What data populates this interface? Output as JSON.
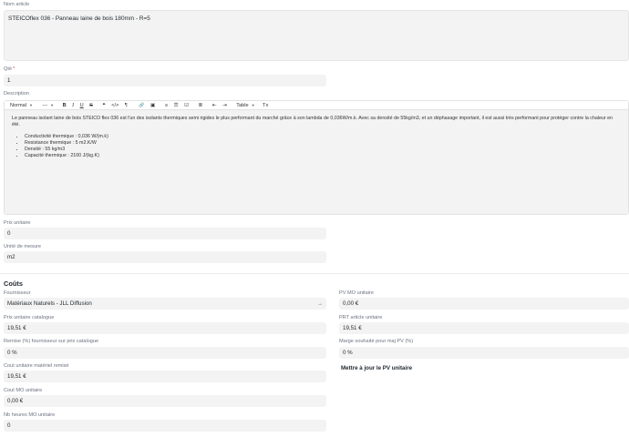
{
  "article": {
    "name_label": "Nom article",
    "name_value": "STEICOflex 036 - Panneau laine de bois 180mm - R=5",
    "qty_label": "Qté",
    "qty_required": "*",
    "qty_value": "1",
    "desc_label": "Description"
  },
  "toolbar": {
    "format": "Normal",
    "size": "---",
    "bold": "B",
    "italic": "I",
    "underline": "U",
    "strike": "S",
    "quote": "❝",
    "code": "</>",
    "rtl": "¶",
    "link": "🔗",
    "image": "▣",
    "ordered_list": "≡",
    "bullet_list": "☰",
    "check_list": "☑",
    "align": "≣",
    "outdent": "⇤",
    "indent": "⇥",
    "table": "Table",
    "clear": "Tx"
  },
  "description": {
    "paragraph": "Le panneau isolant laine de bois STEICO flex 036 est l'un des isolants thermiques semi rigides le plus performant du marché grâce à son lambda de 0,036W/m.k. Avec sa densité de 55kg/m3, et un déphasage important, il est aussi très performant pour protéger contre la chaleur en été.",
    "bullets": [
      "Conductivité thermique : 0,036 W/(m.k)",
      "Resistance thermique : 5 m2.K/W",
      "Densité : 55 kg/m3",
      "Capacité thermique : 2100 J/(kg.K)"
    ]
  },
  "pricing": {
    "unit_price_label": "Prix unitaire",
    "unit_price_value": "0",
    "unit_label": "Unité de mesure",
    "unit_value": "m2"
  },
  "costs": {
    "title": "Coûts",
    "supplier_label": "Fournisseur",
    "supplier_value": "Matériaux Naturels - JLL Diffusion",
    "catalog_price_label": "Prix unitaire catalogue",
    "catalog_price_value": "19,51 €",
    "discount_label": "Remise (%) fournisseur sur prix catalogue",
    "discount_value": "0 %",
    "discounted_cost_label": "Cout unitaire matériel remisé",
    "discounted_cost_value": "19,51 €",
    "labor_cost_label": "Cout MO unitaire",
    "labor_cost_value": "0,00 €",
    "labor_hours_label": "Nb heures MO unitaire",
    "labor_hours_value": "0",
    "pv_labor_label": "PV MO unitaire",
    "pv_labor_value": "0,00 €",
    "prt_label": "PRT article unitaire",
    "prt_value": "19,51 €",
    "margin_label": "Marge souhaité pour maj PV (%)",
    "margin_value": "0 %",
    "update_button": "Mettre à jour le PV unitaire"
  }
}
